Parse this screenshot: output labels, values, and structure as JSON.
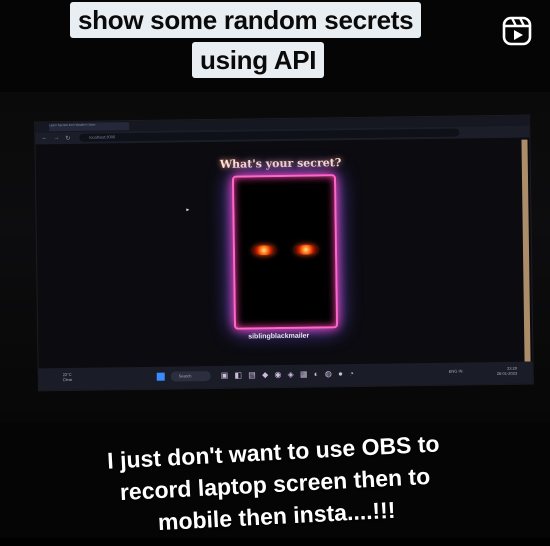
{
  "caption_top": {
    "partial": "",
    "line1": "show some random secrets",
    "line2": "using API"
  },
  "reels_icon": "reels-icon",
  "browser": {
    "tab_title": "Learn Secrets from Weather | New",
    "url": "localhost:3000"
  },
  "page": {
    "heading": "What's your secret?",
    "card_caption": "siblingblackmailer"
  },
  "taskbar": {
    "weather_line1": "22°C",
    "weather_line2": "Clear",
    "search_label": "Search",
    "tray_text": "ENG IN",
    "clock_time": "23:20",
    "clock_date": "26-01-2023"
  },
  "caption_bottom": {
    "line1": "I just don't want to use OBS to",
    "line2": "record laptop screen then to",
    "line3": "mobile then insta....!!!"
  },
  "colors": {
    "caption_bg": "#e9eef2",
    "card_border": "#ff66cc",
    "glow_secondary": "#7a5cff",
    "eye_core": "#ff7a1a"
  }
}
